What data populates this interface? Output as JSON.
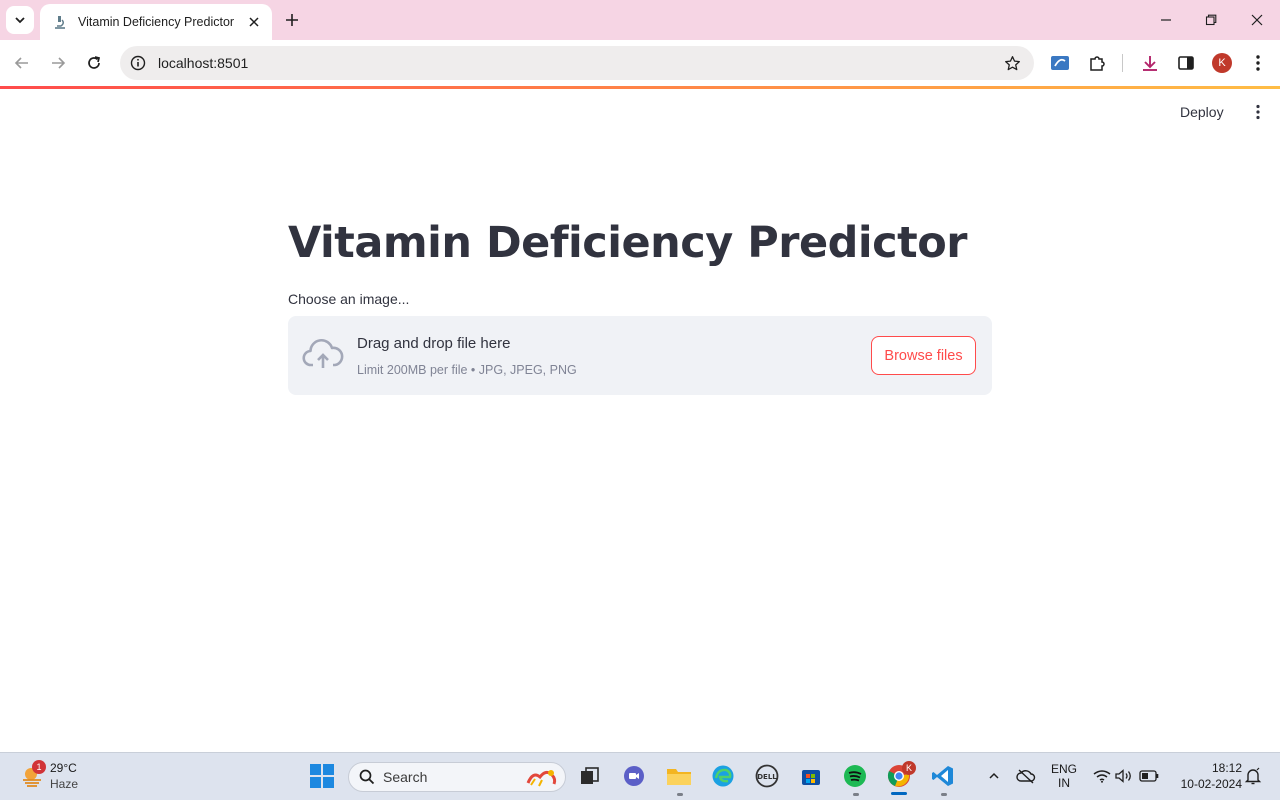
{
  "browser": {
    "tab_title": "Vitamin Deficiency Predictor",
    "url": "localhost:8501",
    "profile_initial": "K"
  },
  "app": {
    "deploy_label": "Deploy",
    "title": "Vitamin Deficiency Predictor",
    "uploader": {
      "label": "Choose an image...",
      "drop_text": "Drag and drop file here",
      "limit_text": "Limit 200MB per file • JPG, JPEG, PNG",
      "browse_label": "Browse files"
    },
    "colors": {
      "accent": "#ff4b4b",
      "text": "#31333f",
      "dropzone_bg": "#f0f2f6"
    }
  },
  "taskbar": {
    "weather": {
      "badge": "1",
      "temp": "29°C",
      "condition": "Haze"
    },
    "search_placeholder": "Search",
    "chrome_badge": "K",
    "language": {
      "line1": "ENG",
      "line2": "IN"
    },
    "clock": {
      "time": "18:12",
      "date": "10-02-2024"
    },
    "apps": [
      "windows-start",
      "search",
      "task-view",
      "meet",
      "file-explorer",
      "edge",
      "dell",
      "store",
      "spotify",
      "chrome",
      "vscode"
    ]
  }
}
